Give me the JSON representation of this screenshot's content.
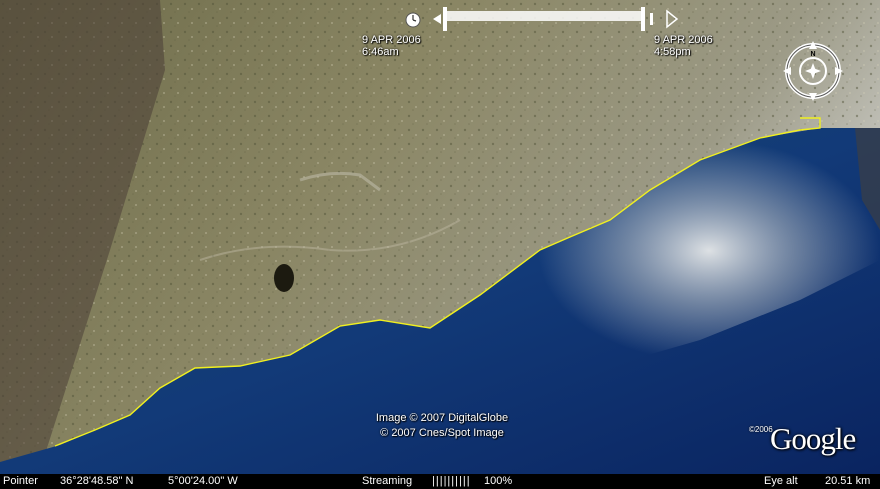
{
  "time_slider": {
    "start_date": "9 APR 2006",
    "start_time": "6:46am",
    "end_date": "9 APR 2006",
    "end_time": "4:58pm"
  },
  "compass": {
    "north_label": "N"
  },
  "credits": {
    "line1": "Image © 2007 DigitalGlobe",
    "line2": "© 2007 Cnes/Spot Image"
  },
  "logo": {
    "year": "©2006",
    "text": "Google"
  },
  "statusbar": {
    "pointer_label": "Pointer",
    "latitude": "36°28'48.58\" N",
    "longitude": "5°00'24.00\" W",
    "streaming_label": "Streaming",
    "streaming_bars": "||||||||||",
    "streaming_percent": "100%",
    "eye_alt_label": "Eye alt",
    "eye_alt_value": "20.51 km"
  },
  "colors": {
    "coastline": "#f0f020",
    "sea_deep": "#0d2a6e",
    "sea_shallow": "#1d4a6a",
    "land": "#7d7a58"
  }
}
